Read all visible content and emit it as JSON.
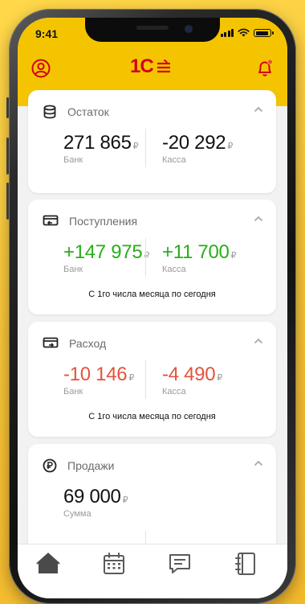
{
  "status_bar": {
    "time": "9:41"
  },
  "header": {
    "logo_text": "1С",
    "profile_icon": "profile-icon",
    "notification_icon": "bell-icon"
  },
  "cards": [
    {
      "icon": "coins-icon",
      "title": "Остаток",
      "left": {
        "value": "271 865",
        "currency": "₽",
        "label": "Банк"
      },
      "right": {
        "value": "-20 292",
        "currency": "₽",
        "label": "Касса"
      }
    },
    {
      "icon": "income-icon",
      "title": "Поступления",
      "left": {
        "value": "+147 975",
        "currency": "₽",
        "label": "Банк"
      },
      "right": {
        "value": "+11 700",
        "currency": "₽",
        "label": "Касса"
      },
      "note": "С 1го числа месяца по сегодня"
    },
    {
      "icon": "expense-icon",
      "title": "Расход",
      "left": {
        "value": "-10 146",
        "currency": "₽",
        "label": "Банк"
      },
      "right": {
        "value": "-4 490",
        "currency": "₽",
        "label": "Касса"
      },
      "note": "С 1го числа месяца по сегодня"
    },
    {
      "icon": "ruble-icon",
      "title": "Продажи",
      "left": {
        "value": "69 000",
        "currency": "₽",
        "label": "Сумма"
      }
    }
  ],
  "tabbar": {
    "items": [
      {
        "icon": "home-icon",
        "active": true
      },
      {
        "icon": "calendar-icon",
        "active": false
      },
      {
        "icon": "chat-icon",
        "active": false
      },
      {
        "icon": "notebook-icon",
        "active": false
      }
    ]
  },
  "colors": {
    "accent_yellow": "#f5c400",
    "brand_red": "#d0021b",
    "positive": "#27ae1a",
    "negative": "#e4533a",
    "icon_gray": "#6b6b6b"
  }
}
